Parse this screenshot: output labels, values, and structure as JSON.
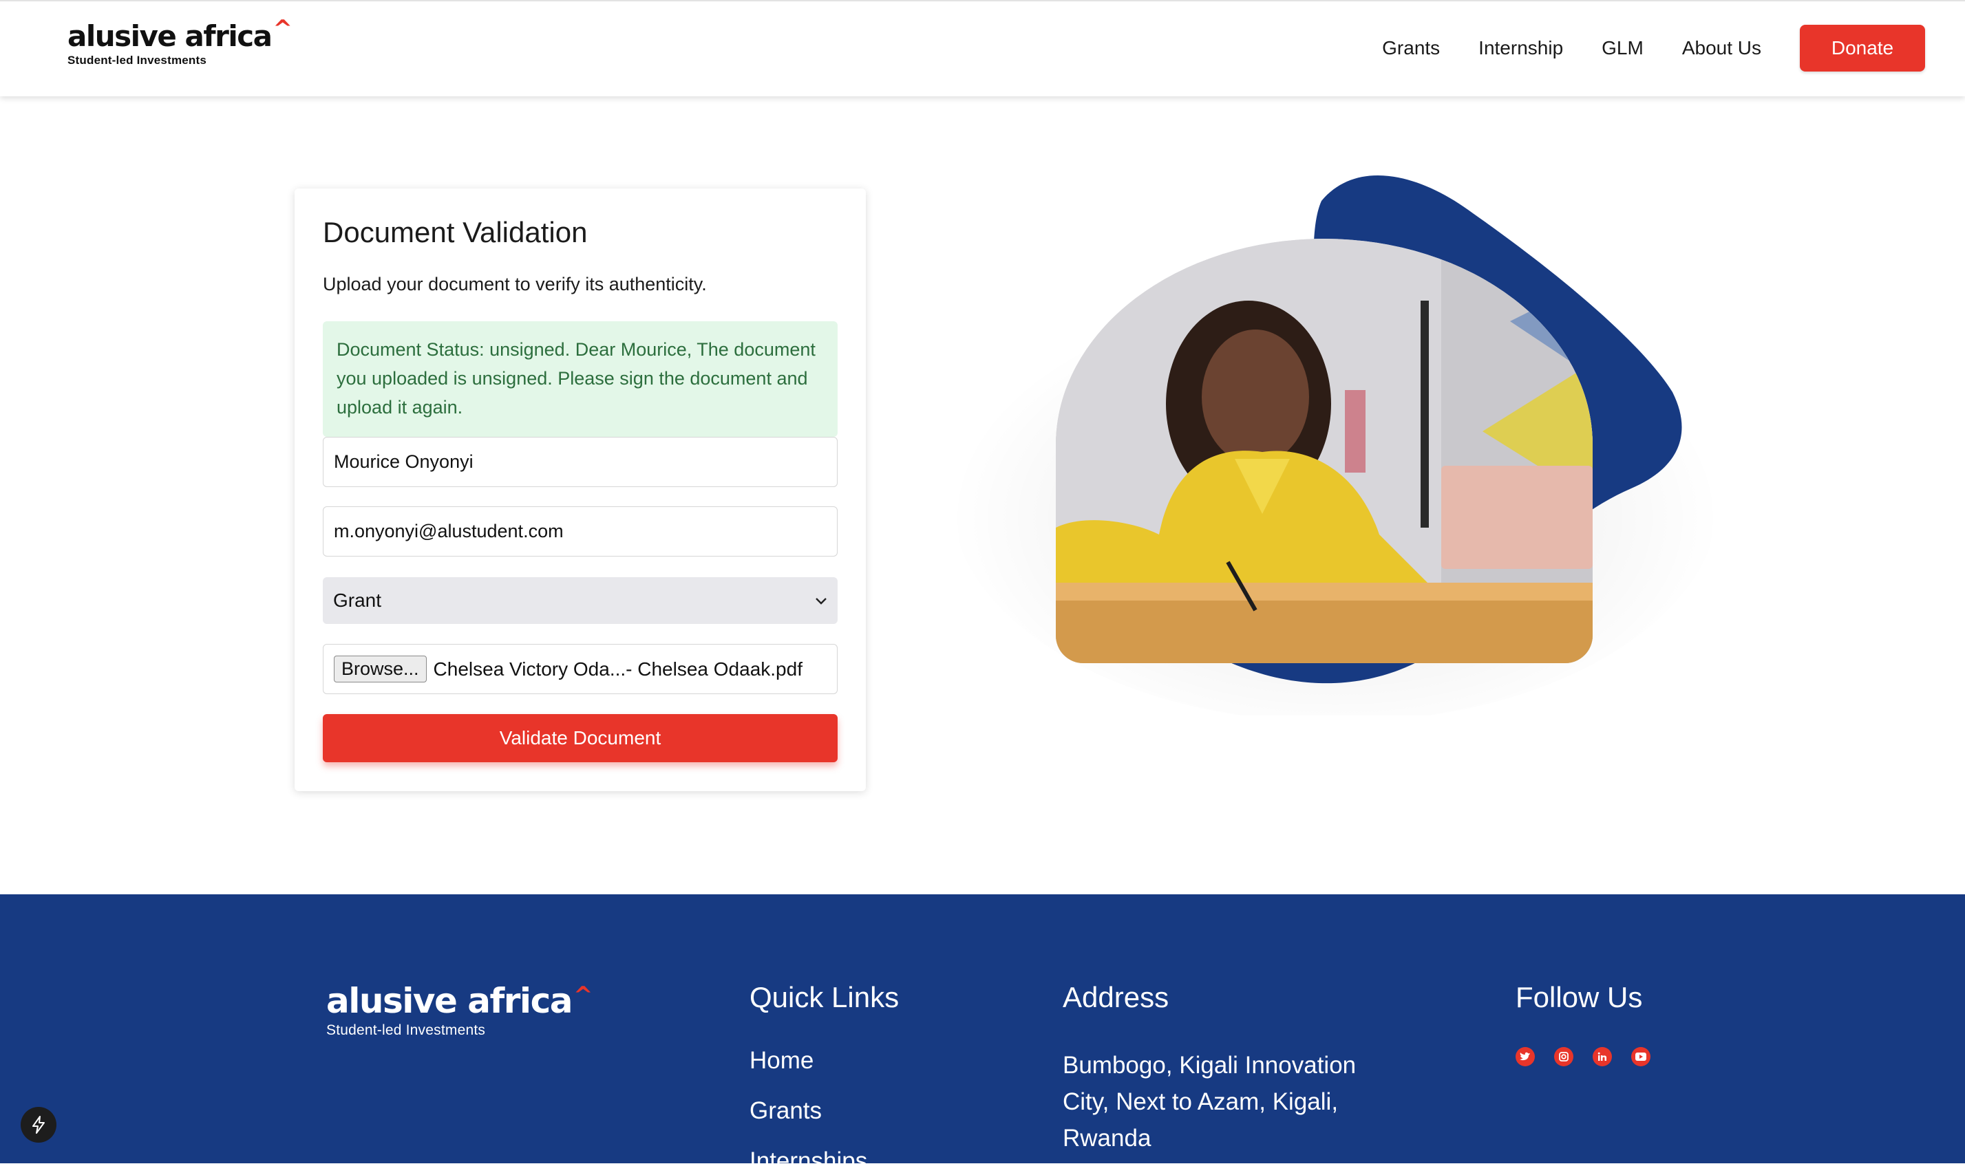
{
  "brand": {
    "name": "alusive africa",
    "caret": "^",
    "tagline": "Student-led Investments",
    "accent_color": "#e8352a",
    "footer_color": "#173a82"
  },
  "nav": {
    "links": [
      "Grants",
      "Internship",
      "GLM",
      "About Us"
    ],
    "donate": "Donate"
  },
  "form": {
    "title": "Document Validation",
    "subtitle": "Upload your document to verify its authenticity.",
    "status_message": "Document Status: unsigned. Dear Mourice, The document you uploaded is unsigned. Please sign the document and upload it again.",
    "name_value": "Mourice Onyonyi",
    "email_value": "m.onyonyi@alustudent.com",
    "category_selected": "Grant",
    "browse_label": "Browse...",
    "file_name": "Chelsea Victory Oda...- Chelsea Odaak.pdf",
    "submit_label": "Validate Document"
  },
  "footer": {
    "quick_links_title": "Quick Links",
    "quick_links": [
      "Home",
      "Grants",
      "Internships"
    ],
    "address_title": "Address",
    "address": "Bumbogo, Kigali Innovation City, Next to Azam, Kigali, Rwanda",
    "follow_title": "Follow Us",
    "social_icons": [
      "twitter-icon",
      "instagram-icon",
      "linkedin-icon",
      "youtube-icon"
    ]
  }
}
